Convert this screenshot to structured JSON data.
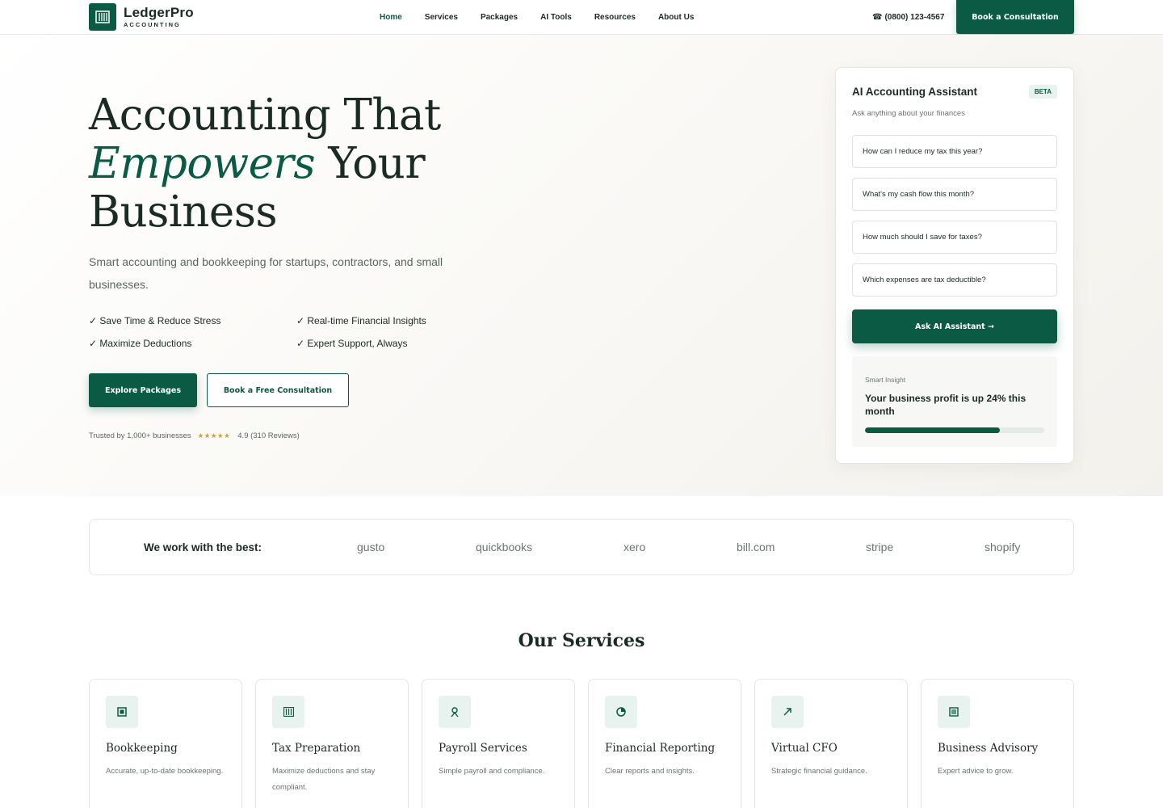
{
  "brand": {
    "name": "LedgerPro",
    "tagline": "ACCOUNTING"
  },
  "nav": {
    "links": [
      "Home",
      "Services",
      "Packages",
      "AI Tools",
      "Resources",
      "About Us"
    ],
    "active": "Home",
    "phone": "(0800) 123-4567",
    "cta": "Book a Consultation"
  },
  "hero": {
    "title_line1": "Accounting That",
    "title_emphasis": "Empowers",
    "title_line2_rest": " Your",
    "title_line3": "Business",
    "subtitle": "Smart accounting and bookkeeping for startups, contractors, and small businesses.",
    "features": [
      "✓ Save Time & Reduce Stress",
      "✓ Real-time Financial Insights",
      "✓ Maximize Deductions",
      "✓ Expert Support, Always"
    ],
    "primary_cta": "Explore Packages",
    "secondary_cta": "Book a Free Consultation",
    "trust_text": "Trusted by 1,000+ businesses",
    "stars": "★★★★★",
    "rating_text": "4.9 (310 Reviews)"
  },
  "assistant": {
    "title": "AI Accounting Assistant",
    "badge": "BETA",
    "subtitle": "Ask anything about your finances",
    "questions": [
      "How can I reduce my tax this year?",
      "What's my cash flow this month?",
      "How much should I save for taxes?",
      "Which expenses are tax deductible?"
    ],
    "ask_button": "Ask AI Assistant →",
    "insight": {
      "label": "Smart Insight",
      "text": "Your business profit is up 24% this month",
      "progress": 0.75
    }
  },
  "partners": {
    "label": "We work with the best:",
    "names": [
      "gusto",
      "quickbooks",
      "xero",
      "bill.com",
      "stripe",
      "shopify"
    ]
  },
  "services": {
    "title": "Our Services",
    "items": [
      {
        "title": "Bookkeeping",
        "desc": "Accurate, up-to-date bookkeeping.",
        "icon": "ledger-icon"
      },
      {
        "title": "Tax Preparation",
        "desc": "Maximize deductions and stay compliant.",
        "icon": "tax-icon"
      },
      {
        "title": "Payroll Services",
        "desc": "Simple payroll and compliance.",
        "icon": "payroll-icon"
      },
      {
        "title": "Financial Reporting",
        "desc": "Clear reports and insights.",
        "icon": "pie-chart-icon"
      },
      {
        "title": "Virtual CFO",
        "desc": "Strategic financial guidance.",
        "icon": "trend-up-icon"
      },
      {
        "title": "Business Advisory",
        "desc": "Expert advice to grow.",
        "icon": "document-icon"
      }
    ]
  },
  "colors": {
    "brand": "#0b5a43",
    "accent_soft": "#e8f2ee",
    "star": "#c9a13b",
    "text": "#1a2a24",
    "muted": "#6b7570"
  }
}
